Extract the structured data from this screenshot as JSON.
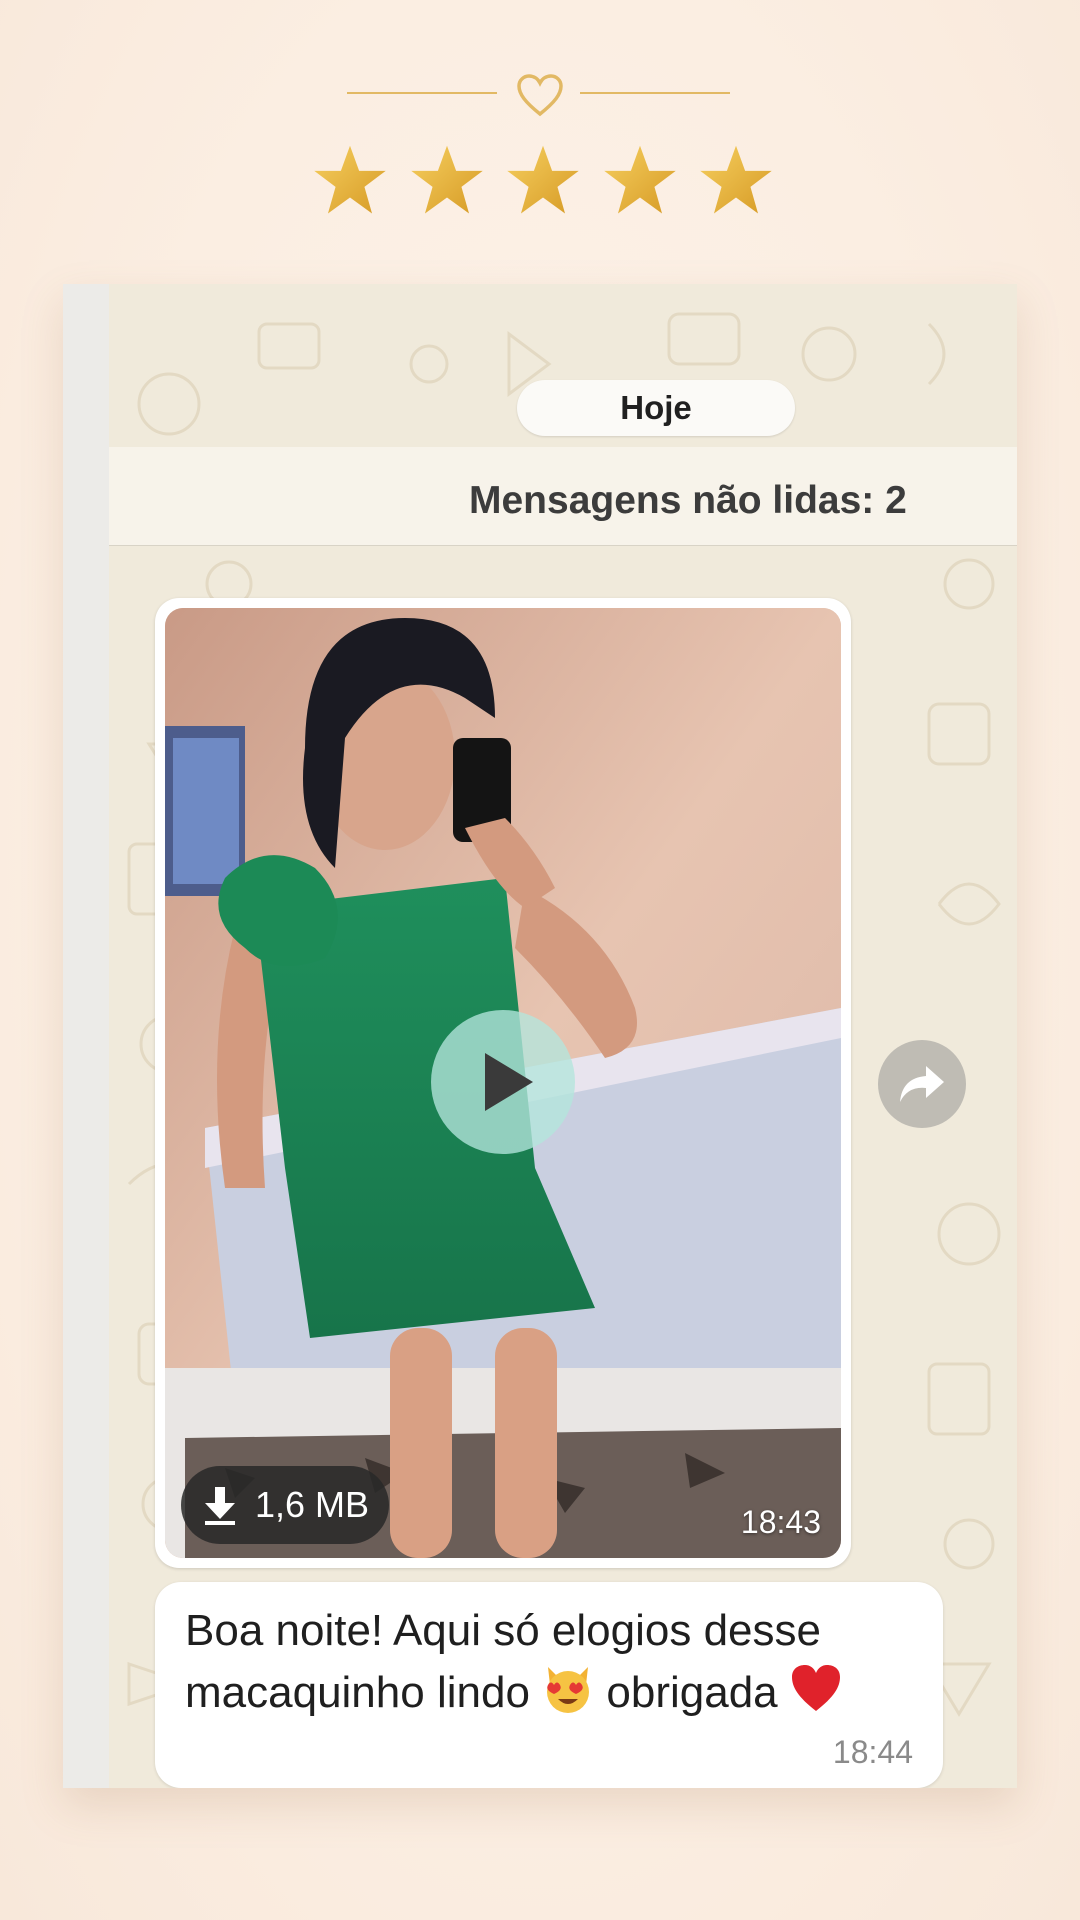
{
  "header": {
    "heart_icon": "heart-outline-icon",
    "rating_stars": 5,
    "rating_max": 5,
    "accent_color": "#e2b964"
  },
  "chat": {
    "date_label": "Hoje",
    "unread_label": "Mensagens não lidas: 2",
    "video_message": {
      "file_size": "1,6 MB",
      "time": "18:43",
      "download_icon": "download-arrow-icon",
      "play_icon": "play-icon",
      "forward_icon": "forward-share-icon"
    },
    "text_message": {
      "line1": "Boa noite! Aqui só elogios desse",
      "line2_part1": "macaquinho lindo",
      "line2_part2": "obrigada",
      "emoji_cat": "smiling-cat-heart-eyes-emoji",
      "emoji_heart": "red-heart-emoji",
      "time": "18:44"
    }
  }
}
